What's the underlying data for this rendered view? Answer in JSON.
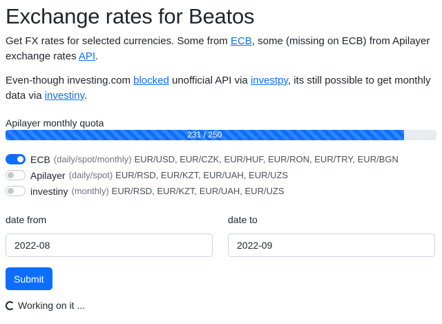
{
  "header": {
    "title": "Exchange rates for Beatos"
  },
  "intro": {
    "p1_before": "Get FX rates for selected currencies. Some from ",
    "p1_link1": "ECB",
    "p1_middle": ", some (missing on ECB) from Apilayer exchange rates ",
    "p1_link2": "API",
    "p1_after": ".",
    "p2_before": "Even-though investing.com ",
    "p2_link1": "blocked",
    "p2_middle1": " unofficial API via ",
    "p2_link2": "investpy",
    "p2_middle2": ", its still possible to get monthly data via ",
    "p2_link3": "investiny",
    "p2_after": "."
  },
  "quota": {
    "label": "Apilayer monthly quota",
    "text": "231 / 250",
    "used": 231,
    "max": 250,
    "fraction": 0.924
  },
  "sources": [
    {
      "name": "ECB",
      "frequency": "(daily/spot/monthly)",
      "currencies": "EUR/USD, EUR/CZK, EUR/HUF, EUR/RON, EUR/TRY, EUR/BGN",
      "enabled": true
    },
    {
      "name": "Apilayer",
      "frequency": "(daily/spot)",
      "currencies": "EUR/RSD, EUR/KZT, EUR/UAH, EUR/UZS",
      "enabled": false
    },
    {
      "name": "investiny",
      "frequency": "(monthly)",
      "currencies": "EUR/RSD, EUR/KZT, EUR/UAH, EUR/UZS",
      "enabled": false
    }
  ],
  "form": {
    "date_from_label": "date from",
    "date_from_value": "2022-08",
    "date_to_label": "date to",
    "date_to_value": "2022-09",
    "submit_label": "Submit"
  },
  "status": {
    "text": "Working on it ..."
  },
  "colors": {
    "primary": "#0d6efd",
    "track": "#e9ecef"
  }
}
